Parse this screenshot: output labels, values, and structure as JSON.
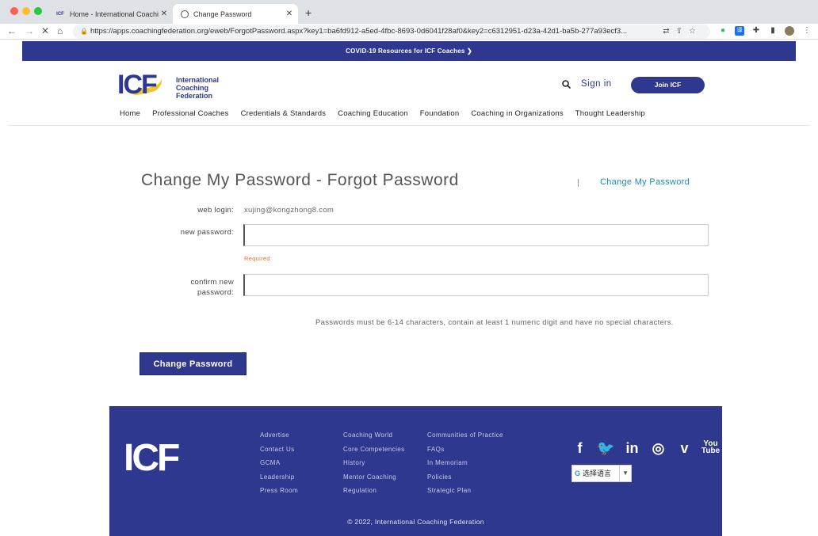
{
  "browser": {
    "tabs": [
      {
        "title": "Home - International Coaching",
        "favicon": "ICF"
      },
      {
        "title": "Change Password"
      }
    ],
    "url": "https://apps.coachingfederation.org/eweb/ForgotPassword.aspx?key1=ba6fd912-a5ed-4fbc-8693-0d6041f28af0&key2=c6312951-d23a-42d1-ba5b-277a93ecf3..."
  },
  "site": {
    "banner": "COVID-19 Resources for ICF Coaches ❯",
    "logo": {
      "mark": "ICF",
      "line1": "International",
      "line2": "Coaching",
      "line3": "Federation"
    },
    "signin": "Sign in",
    "join": "Join ICF",
    "nav": [
      "Home",
      "Professional Coaches",
      "Credentials & Standards",
      "Coaching Education",
      "Foundation",
      "Coaching in Organizations",
      "Thought Leadership"
    ]
  },
  "form": {
    "title": "Change My Password - Forgot Password",
    "side_link": "Change My Password",
    "web_login_label": "web login:",
    "web_login_value": "xujing@kongzhong8.com",
    "new_password_label": "new password:",
    "required": "Required",
    "confirm_label_1": "confirm new",
    "confirm_label_2": "password:",
    "hint": "Passwords must be 6-14 characters, contain at least 1 numeric digit and have no special characters.",
    "submit": "Change Password"
  },
  "footer": {
    "logo": "ICF",
    "col1": [
      "Advertise",
      "Contact Us",
      "GCMA",
      "Leadership",
      "Press Room"
    ],
    "col2": [
      "Coaching World",
      "Core Competencies",
      "History",
      "Mentor Coaching",
      "Regulation"
    ],
    "col3": [
      "Communities of Practice",
      "FAQs",
      "In Memoriam",
      "Policies",
      "Strategic Plan"
    ],
    "social_icons": [
      "facebook-icon",
      "twitter-icon",
      "linkedin-icon",
      "instagram-icon",
      "vimeo-icon",
      "youtube-icon"
    ],
    "language": "选择语言",
    "copyright": "© 2022, International Coaching Federation"
  },
  "colors": {
    "brand": "#2f388f",
    "accent": "#f3c324",
    "link": "#1c8ab5",
    "required": "#f26f21"
  }
}
